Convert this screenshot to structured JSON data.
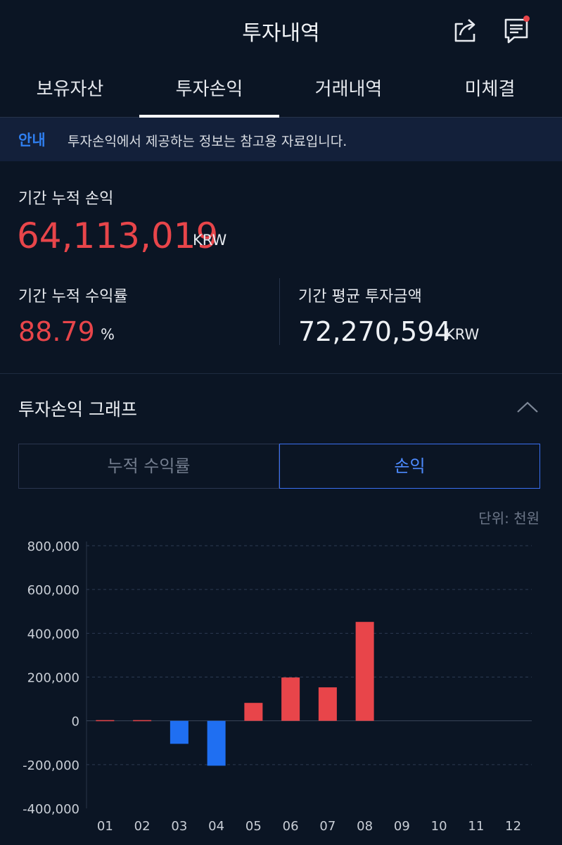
{
  "header": {
    "title": "투자내역"
  },
  "tabs": [
    {
      "label": "보유자산"
    },
    {
      "label": "투자손익"
    },
    {
      "label": "거래내역"
    },
    {
      "label": "미체결"
    }
  ],
  "notice": {
    "label": "안내",
    "text": "투자손익에서 제공하는 정보는 참고용 자료입니다."
  },
  "summary": {
    "cumulative_pnl_label": "기간 누적 손익",
    "cumulative_pnl_value": "64,113,019",
    "cumulative_pnl_unit": "KRW",
    "return_label": "기간 누적 수익률",
    "return_value": "88.79",
    "return_unit": "%",
    "avg_invest_label": "기간 평균 투자금액",
    "avg_invest_value": "72,270,594",
    "avg_invest_unit": "KRW"
  },
  "graph": {
    "title": "투자손익 그래프",
    "toggle_left": "누적 수익률",
    "toggle_right": "손익",
    "unit_note": "단위: 천원"
  },
  "colors": {
    "positive": "#e8454a",
    "negative": "#1f6ff2",
    "accent": "#3a6ff2"
  },
  "chart_data": {
    "type": "bar",
    "categories": [
      "01",
      "02",
      "03",
      "04",
      "05",
      "06",
      "07",
      "08",
      "09",
      "10",
      "11",
      "12"
    ],
    "values": [
      0,
      0,
      -105000,
      -205000,
      82000,
      198000,
      153000,
      452000,
      0,
      0,
      0,
      0
    ],
    "ylim": [
      -400000,
      800000
    ],
    "yticks": [
      800000,
      600000,
      400000,
      200000,
      0,
      -200000,
      -400000
    ],
    "ytick_labels": [
      "800,000",
      "600,000",
      "400,000",
      "200,000",
      "0",
      "-200,000",
      "-400,000"
    ],
    "grid": true
  }
}
